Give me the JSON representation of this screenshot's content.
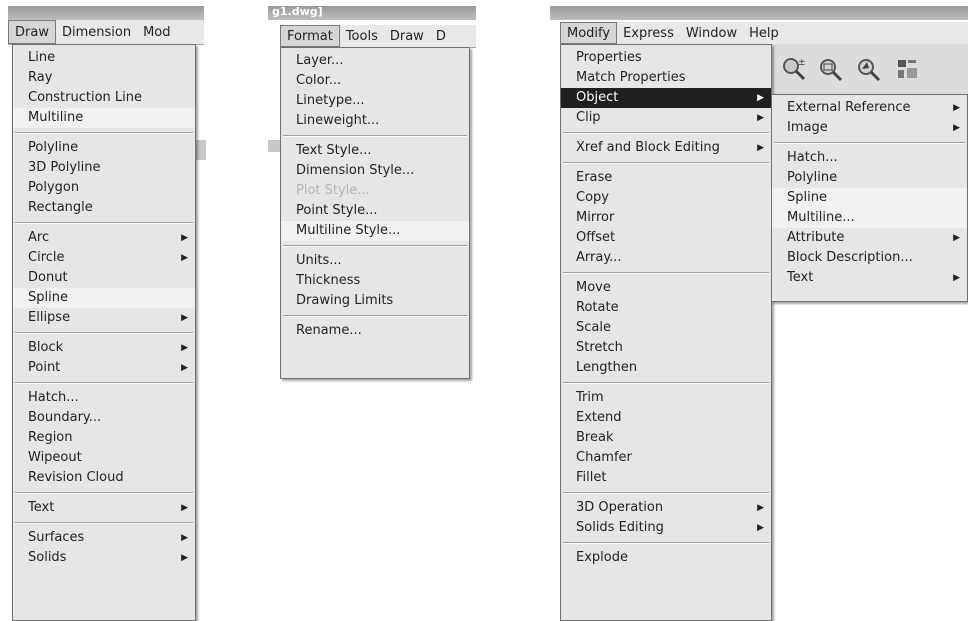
{
  "left": {
    "menubar": [
      "Draw",
      "Dimension",
      "Mod"
    ],
    "menu_groups": [
      [
        "Line",
        "Ray",
        "Construction Line",
        "Multiline"
      ],
      [
        "Polyline",
        "3D Polyline",
        "Polygon",
        "Rectangle"
      ],
      [
        "Arc",
        "Circle",
        "Donut",
        "Spline",
        "Ellipse"
      ],
      [
        "Block",
        "Point"
      ],
      [
        "Hatch...",
        "Boundary...",
        "Region",
        "Wipeout",
        "Revision Cloud"
      ],
      [
        "Text"
      ],
      [
        "Surfaces",
        "Solids"
      ]
    ]
  },
  "middle": {
    "title_fragment": "g1.dwg]",
    "menubar": [
      "Format",
      "Tools",
      "Draw",
      "D"
    ],
    "menu_groups": [
      [
        "Layer...",
        "Color...",
        "Linetype...",
        "Lineweight..."
      ],
      [
        "Text Style...",
        "Dimension Style...",
        "Plot Style...",
        "Point Style...",
        "Multiline Style..."
      ],
      [
        "Units...",
        "Thickness",
        "Drawing Limits"
      ],
      [
        "Rename..."
      ]
    ]
  },
  "right": {
    "menubar": [
      "Modify",
      "Express",
      "Window",
      "Help"
    ],
    "menu_groups": [
      [
        "Properties",
        "Match Properties",
        "Object",
        "Clip"
      ],
      [
        "Xref and Block Editing"
      ],
      [
        "Erase",
        "Copy",
        "Mirror",
        "Offset",
        "Array..."
      ],
      [
        "Move",
        "Rotate",
        "Scale",
        "Stretch",
        "Lengthen"
      ],
      [
        "Trim",
        "Extend",
        "Break",
        "Chamfer",
        "Fillet"
      ],
      [
        "3D Operation",
        "Solids Editing"
      ],
      [
        "Explode"
      ]
    ],
    "submenu_groups": [
      [
        "External Reference",
        "Image"
      ],
      [
        "Hatch...",
        "Polyline",
        "Spline",
        "Multiline...",
        "Attribute",
        "Block Description...",
        "Text"
      ]
    ]
  },
  "icons": [
    "zoom-realtime-icon",
    "zoom-window-icon",
    "zoom-previous-icon",
    "properties-toolbar-icon"
  ]
}
